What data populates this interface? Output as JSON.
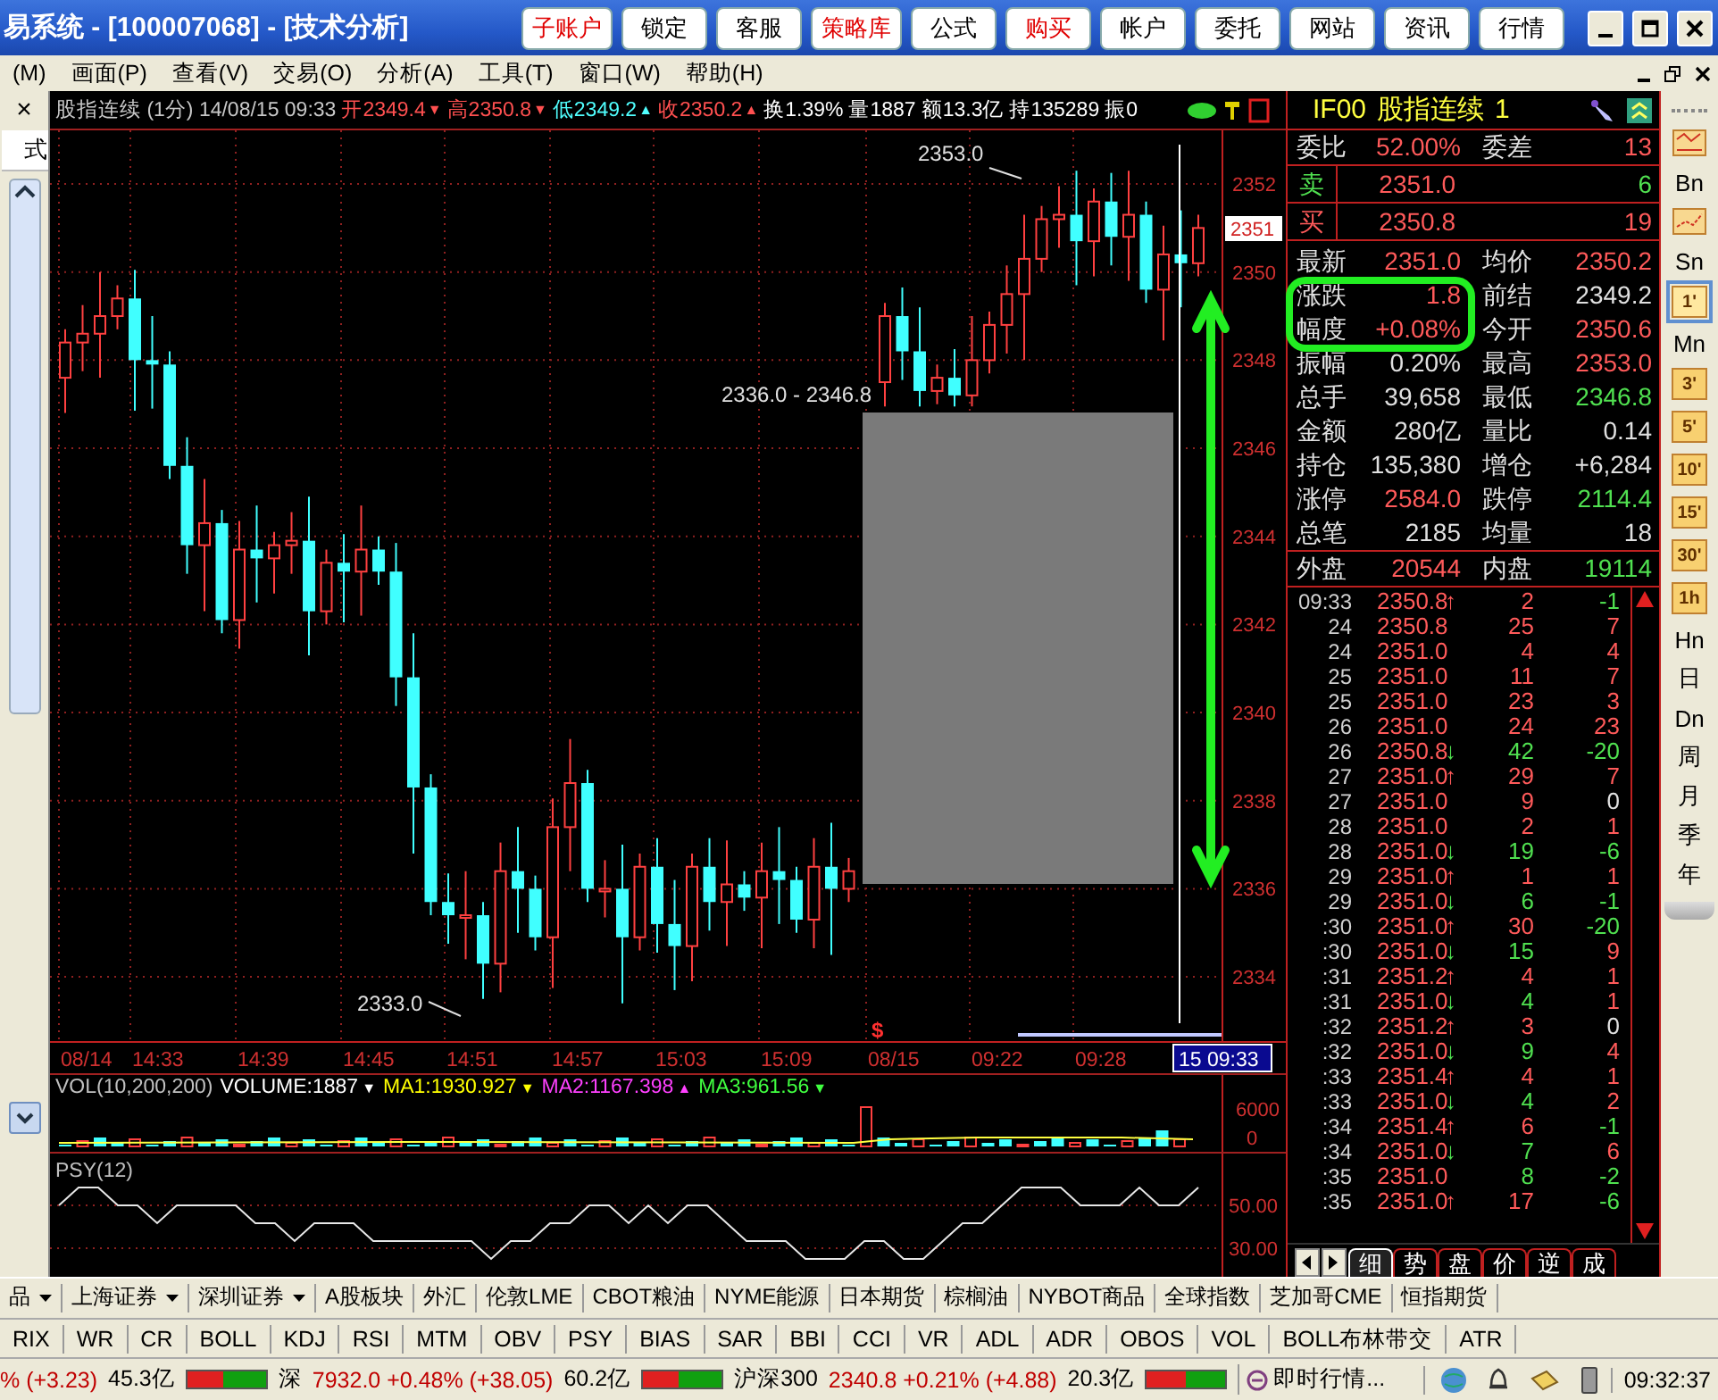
{
  "window": {
    "title": "易系统 - [100007068] - [技术分析]",
    "buttons": [
      {
        "label": "子账户",
        "accent": true
      },
      {
        "label": "锁定",
        "accent": false
      },
      {
        "label": "客服",
        "accent": false
      },
      {
        "label": "策略库",
        "accent": true
      },
      {
        "label": "公式",
        "accent": false
      },
      {
        "label": "购买",
        "accent": true
      },
      {
        "label": "帐户",
        "accent": false
      },
      {
        "label": "委托",
        "accent": false
      },
      {
        "label": "网站",
        "accent": false
      },
      {
        "label": "资讯",
        "accent": false
      },
      {
        "label": "行情",
        "accent": false
      }
    ]
  },
  "menu": {
    "items": [
      "(M)",
      "画面(P)",
      "查看(V)",
      "交易(O)",
      "分析(A)",
      "工具(T)",
      "窗口(W)",
      "帮助(H)"
    ]
  },
  "sidebar": {
    "close": "×",
    "label": "式"
  },
  "chart": {
    "header": [
      {
        "text": "股指连续 (1分) 14/08/15 09:33",
        "color": "#c8c8c8"
      },
      {
        "text": "开2349.4",
        "color": "#ff5050",
        "arrow": "▼"
      },
      {
        "text": "高2350.8",
        "color": "#ff5050",
        "arrow": "▼"
      },
      {
        "text": "低2349.2",
        "color": "#50ffff",
        "arrow": "▲"
      },
      {
        "text": "收2350.2",
        "color": "#ff5050",
        "arrow": "▲"
      },
      {
        "text": "换1.39%",
        "color": "#ffffff"
      },
      {
        "text": "量1887",
        "color": "#ffffff"
      },
      {
        "text": "额13.3亿",
        "color": "#ffffff"
      },
      {
        "text": "持135289",
        "color": "#ffffff"
      },
      {
        "text": "振0",
        "color": "#ffffff"
      }
    ],
    "price_labels": [
      "2352",
      "2350",
      "2348",
      "2346",
      "2344",
      "2342",
      "2340",
      "2338",
      "2336",
      "2334"
    ],
    "current_price": "2351",
    "high_label": "2353.0",
    "range_label": "2336.0 - 2346.8",
    "low_label": "2333.0",
    "marker": "$",
    "time_labels": [
      "08/14",
      "14:33",
      "14:39",
      "14:45",
      "14:51",
      "14:57",
      "15:03",
      "15:09",
      "08/15",
      "09:22",
      "09:28"
    ],
    "time_cursor": "15 09:33",
    "volume": {
      "title": "VOL(10,200,200)",
      "items": [
        {
          "text": "VOLUME:1887",
          "color": "#ffffff",
          "arrow": "▼"
        },
        {
          "text": "MA1:1930.927",
          "color": "#ffff00",
          "arrow": "▼"
        },
        {
          "text": "MA2:1167.398",
          "color": "#ff40ff",
          "arrow": "▲"
        },
        {
          "text": "MA3:961.56",
          "color": "#40ff40",
          "arrow": "▼"
        }
      ],
      "axis": [
        "6000",
        "0"
      ]
    },
    "psy": {
      "title": "PSY(12)",
      "axis": [
        "50.00",
        "30.00"
      ]
    }
  },
  "quote": {
    "header": {
      "symbol": "IF00",
      "name": "股指连续",
      "period": "1"
    },
    "ratio": [
      {
        "label": "委比",
        "value": "52.00%",
        "color": "#ff5a5a"
      },
      {
        "label": "委差",
        "value": "13",
        "color": "#ff5a5a"
      }
    ],
    "orders": [
      {
        "kind": "sell",
        "label": "卖",
        "price": "2351.0",
        "volume": "6"
      },
      {
        "kind": "buy",
        "label": "买",
        "price": "2350.8",
        "volume": "19"
      }
    ],
    "stats": [
      [
        {
          "label": "最新",
          "value": "2351.0",
          "color": "#ff5a5a"
        },
        {
          "label": "均价",
          "value": "2350.2",
          "color": "#ff5a5a"
        }
      ],
      [
        {
          "label": "涨跌",
          "value": "1.8",
          "color": "#ff5a5a"
        },
        {
          "label": "前结",
          "value": "2349.2",
          "color": "#e0e0e0"
        }
      ],
      [
        {
          "label": "幅度",
          "value": "+0.08%",
          "color": "#ff5a5a"
        },
        {
          "label": "今开",
          "value": "2350.6",
          "color": "#ff5a5a"
        }
      ],
      [
        {
          "label": "振幅",
          "value": "0.20%",
          "color": "#e0e0e0"
        },
        {
          "label": "最高",
          "value": "2353.0",
          "color": "#ff5a5a"
        }
      ],
      [
        {
          "label": "总手",
          "value": "39,658",
          "color": "#e0e0e0"
        },
        {
          "label": "最低",
          "value": "2346.8",
          "color": "#50e050"
        }
      ],
      [
        {
          "label": "金额",
          "value": "280亿",
          "color": "#e0e0e0"
        },
        {
          "label": "量比",
          "value": "0.14",
          "color": "#e0e0e0"
        }
      ],
      [
        {
          "label": "持仓",
          "value": "135,380",
          "color": "#e0e0e0"
        },
        {
          "label": "增仓",
          "value": "+6,284",
          "color": "#e0e0e0"
        }
      ],
      [
        {
          "label": "涨停",
          "value": "2584.0",
          "color": "#ff5a5a"
        },
        {
          "label": "跌停",
          "value": "2114.4",
          "color": "#50e050"
        }
      ],
      [
        {
          "label": "总笔",
          "value": "2185",
          "color": "#e0e0e0"
        },
        {
          "label": "均量",
          "value": "18",
          "color": "#e0e0e0"
        }
      ]
    ],
    "totals": [
      {
        "label": "外盘",
        "value": "20544",
        "color": "#ff5a5a"
      },
      {
        "label": "内盘",
        "value": "19114",
        "color": "#50e050"
      }
    ],
    "ticks": [
      {
        "time": "09:33",
        "price": "2350.8",
        "arrow": {
          "text": "↑",
          "color": "#ff5a5a"
        },
        "volume": {
          "text": "2",
          "color": "#ff5a5a"
        },
        "change": {
          "text": "-1",
          "color": "#50e050"
        }
      },
      {
        "time": "24",
        "price": "2350.8",
        "volume": {
          "text": "25",
          "color": "#ff5a5a"
        },
        "change": {
          "text": "7",
          "color": "#ff5a5a"
        }
      },
      {
        "time": "24",
        "price": "2351.0",
        "volume": {
          "text": "4",
          "color": "#ff5a5a"
        },
        "change": {
          "text": "4",
          "color": "#ff5a5a"
        }
      },
      {
        "time": "25",
        "price": "2351.0",
        "volume": {
          "text": "11",
          "color": "#ff5a5a"
        },
        "change": {
          "text": "7",
          "color": "#ff5a5a"
        }
      },
      {
        "time": "25",
        "price": "2351.0",
        "volume": {
          "text": "23",
          "color": "#ff5a5a"
        },
        "change": {
          "text": "3",
          "color": "#ff5a5a"
        }
      },
      {
        "time": "26",
        "price": "2351.0",
        "volume": {
          "text": "24",
          "color": "#ff5a5a"
        },
        "change": {
          "text": "23",
          "color": "#ff5a5a"
        }
      },
      {
        "time": "26",
        "price": "2350.8",
        "arrow": {
          "text": "↓",
          "color": "#50e050"
        },
        "volume": {
          "text": "42",
          "color": "#50e050"
        },
        "change": {
          "text": "-20",
          "color": "#50e050"
        }
      },
      {
        "time": "27",
        "price": "2351.0",
        "arrow": {
          "text": "↑",
          "color": "#ff5a5a"
        },
        "volume": {
          "text": "29",
          "color": "#ff5a5a"
        },
        "change": {
          "text": "7",
          "color": "#ff5a5a"
        }
      },
      {
        "time": "27",
        "price": "2351.0",
        "volume": {
          "text": "9",
          "color": "#ff5a5a"
        },
        "change": {
          "text": "0",
          "color": "#e0e0e0"
        }
      },
      {
        "time": "28",
        "price": "2351.0",
        "volume": {
          "text": "2",
          "color": "#ff5a5a"
        },
        "change": {
          "text": "1",
          "color": "#ff5a5a"
        }
      },
      {
        "time": "28",
        "price": "2351.0",
        "arrow": {
          "text": "↓",
          "color": "#50e050"
        },
        "volume": {
          "text": "19",
          "color": "#50e050"
        },
        "change": {
          "text": "-6",
          "color": "#50e050"
        }
      },
      {
        "time": "29",
        "price": "2351.0",
        "arrow": {
          "text": "↑",
          "color": "#ff5a5a"
        },
        "volume": {
          "text": "1",
          "color": "#ff5a5a"
        },
        "change": {
          "text": "1",
          "color": "#ff5a5a"
        }
      },
      {
        "time": "29",
        "price": "2351.0",
        "arrow": {
          "text": "↓",
          "color": "#50e050"
        },
        "volume": {
          "text": "6",
          "color": "#50e050"
        },
        "change": {
          "text": "-1",
          "color": "#50e050"
        }
      },
      {
        "time": ":30",
        "price": "2351.0",
        "arrow": {
          "text": "↑",
          "color": "#ff5a5a"
        },
        "volume": {
          "text": "30",
          "color": "#ff5a5a"
        },
        "change": {
          "text": "-20",
          "color": "#50e050"
        }
      },
      {
        "time": ":30",
        "price": "2351.0",
        "arrow": {
          "text": "↓",
          "color": "#50e050"
        },
        "volume": {
          "text": "15",
          "color": "#50e050"
        },
        "change": {
          "text": "9",
          "color": "#ff5a5a"
        }
      },
      {
        "time": ":31",
        "price": "2351.2",
        "arrow": {
          "text": "↑",
          "color": "#ff5a5a"
        },
        "volume": {
          "text": "4",
          "color": "#ff5a5a"
        },
        "change": {
          "text": "1",
          "color": "#ff5a5a"
        }
      },
      {
        "time": ":31",
        "price": "2351.0",
        "arrow": {
          "text": "↓",
          "color": "#50e050"
        },
        "volume": {
          "text": "4",
          "color": "#50e050"
        },
        "change": {
          "text": "1",
          "color": "#ff5a5a"
        }
      },
      {
        "time": ":32",
        "price": "2351.2",
        "arrow": {
          "text": "↑",
          "color": "#ff5a5a"
        },
        "volume": {
          "text": "3",
          "color": "#ff5a5a"
        },
        "change": {
          "text": "0",
          "color": "#e0e0e0"
        }
      },
      {
        "time": ":32",
        "price": "2351.0",
        "arrow": {
          "text": "↓",
          "color": "#50e050"
        },
        "volume": {
          "text": "9",
          "color": "#50e050"
        },
        "change": {
          "text": "4",
          "color": "#ff5a5a"
        }
      },
      {
        "time": ":33",
        "price": "2351.4",
        "arrow": {
          "text": "↑",
          "color": "#ff5a5a"
        },
        "volume": {
          "text": "4",
          "color": "#ff5a5a"
        },
        "change": {
          "text": "1",
          "color": "#ff5a5a"
        }
      },
      {
        "time": ":33",
        "price": "2351.0",
        "arrow": {
          "text": "↓",
          "color": "#50e050"
        },
        "volume": {
          "text": "4",
          "color": "#50e050"
        },
        "change": {
          "text": "2",
          "color": "#ff5a5a"
        }
      },
      {
        "time": ":34",
        "price": "2351.4",
        "arrow": {
          "text": "↑",
          "color": "#ff5a5a"
        },
        "volume": {
          "text": "6",
          "color": "#ff5a5a"
        },
        "change": {
          "text": "-1",
          "color": "#50e050"
        }
      },
      {
        "time": ":34",
        "price": "2351.0",
        "arrow": {
          "text": "↓",
          "color": "#50e050"
        },
        "volume": {
          "text": "7",
          "color": "#50e050"
        },
        "change": {
          "text": "6",
          "color": "#ff5a5a"
        }
      },
      {
        "time": ":35",
        "price": "2351.0",
        "volume": {
          "text": "8",
          "color": "#50e050"
        },
        "change": {
          "text": "-2",
          "color": "#50e050"
        }
      },
      {
        "time": ":35",
        "price": "2351.0",
        "arrow": {
          "text": "↑",
          "color": "#ff5a5a"
        },
        "volume": {
          "text": "17",
          "color": "#ff5a5a"
        },
        "change": {
          "text": "-6",
          "color": "#50e050"
        }
      }
    ],
    "tabs": [
      {
        "label": "细",
        "selected": true
      },
      {
        "label": "势",
        "selected": false
      },
      {
        "label": "盘",
        "selected": false
      },
      {
        "label": "价",
        "selected": false
      },
      {
        "label": "逆",
        "selected": false
      },
      {
        "label": "成",
        "selected": false
      }
    ]
  },
  "periods": [
    {
      "kind": "icon",
      "selected": false
    },
    {
      "kind": "text",
      "label": "Bn",
      "selected": false
    },
    {
      "kind": "icon",
      "selected": false
    },
    {
      "kind": "text",
      "label": "Sn",
      "selected": false
    },
    {
      "kind": "badge",
      "label": "1'",
      "selected": true
    },
    {
      "kind": "text",
      "label": "Mn",
      "selected": false
    },
    {
      "kind": "badge",
      "label": "3'",
      "selected": false
    },
    {
      "kind": "badge",
      "label": "5'",
      "selected": false
    },
    {
      "kind": "badge",
      "label": "10'",
      "selected": false
    },
    {
      "kind": "badge",
      "label": "15'",
      "selected": false
    },
    {
      "kind": "badge",
      "label": "30'",
      "selected": false
    },
    {
      "kind": "badge",
      "label": "1h",
      "selected": false
    },
    {
      "kind": "text",
      "label": "Hn",
      "selected": false
    },
    {
      "kind": "text",
      "label": "日",
      "selected": false
    },
    {
      "kind": "text",
      "label": "Dn",
      "selected": false
    },
    {
      "kind": "text",
      "label": "周",
      "selected": false
    },
    {
      "kind": "text",
      "label": "月",
      "selected": false
    },
    {
      "kind": "text",
      "label": "季",
      "selected": false
    },
    {
      "kind": "text",
      "label": "年",
      "selected": false
    }
  ],
  "market_tabs": [
    {
      "label": "品",
      "dropdown": true
    },
    {
      "label": "上海证券",
      "dropdown": true
    },
    {
      "label": "深圳证券",
      "dropdown": true
    },
    {
      "label": "A股板块",
      "dropdown": false
    },
    {
      "label": "外汇",
      "dropdown": false
    },
    {
      "label": "伦敦LME",
      "dropdown": false
    },
    {
      "label": "CBOT粮油",
      "dropdown": false
    },
    {
      "label": "NYME能源",
      "dropdown": false
    },
    {
      "label": "日本期货",
      "dropdown": false
    },
    {
      "label": "棕榈油",
      "dropdown": false
    },
    {
      "label": "NYBOT商品",
      "dropdown": false
    },
    {
      "label": "全球指数",
      "dropdown": false
    },
    {
      "label": "芝加哥CME",
      "dropdown": false
    },
    {
      "label": "恒指期货",
      "dropdown": false
    }
  ],
  "indicator_tabs": [
    "RIX",
    "WR",
    "CR",
    "BOLL",
    "KDJ",
    "RSI",
    "MTM",
    "OBV",
    "PSY",
    "BIAS",
    "SAR",
    "BBI",
    "CCI",
    "VR",
    "ADL",
    "ADR",
    "OBOS",
    "VOL",
    "BOLL布林带交",
    "ATR"
  ],
  "status_bar": {
    "items": [
      {
        "kind": "text",
        "text": "% (+3.23)",
        "color": "#c00000"
      },
      {
        "kind": "text",
        "text": "45.3亿",
        "color": "#000000"
      },
      {
        "kind": "meter",
        "level": 0.45
      },
      {
        "kind": "text",
        "text": "深",
        "color": "#000000"
      },
      {
        "kind": "text",
        "text": "7932.0 +0.48% (+38.05)",
        "color": "#c00000"
      },
      {
        "kind": "text",
        "text": "60.2亿",
        "color": "#000000"
      },
      {
        "kind": "meter",
        "level": 0.45
      },
      {
        "kind": "text",
        "text": "沪深300",
        "color": "#000000"
      },
      {
        "kind": "text",
        "text": "2340.8 +0.21% (+4.88)",
        "color": "#c00000"
      },
      {
        "kind": "text",
        "text": "20.3亿",
        "color": "#000000"
      },
      {
        "kind": "meter",
        "level": 0.5
      },
      {
        "kind": "link",
        "text": "即时行情..."
      }
    ],
    "time": "09:32:37"
  }
}
